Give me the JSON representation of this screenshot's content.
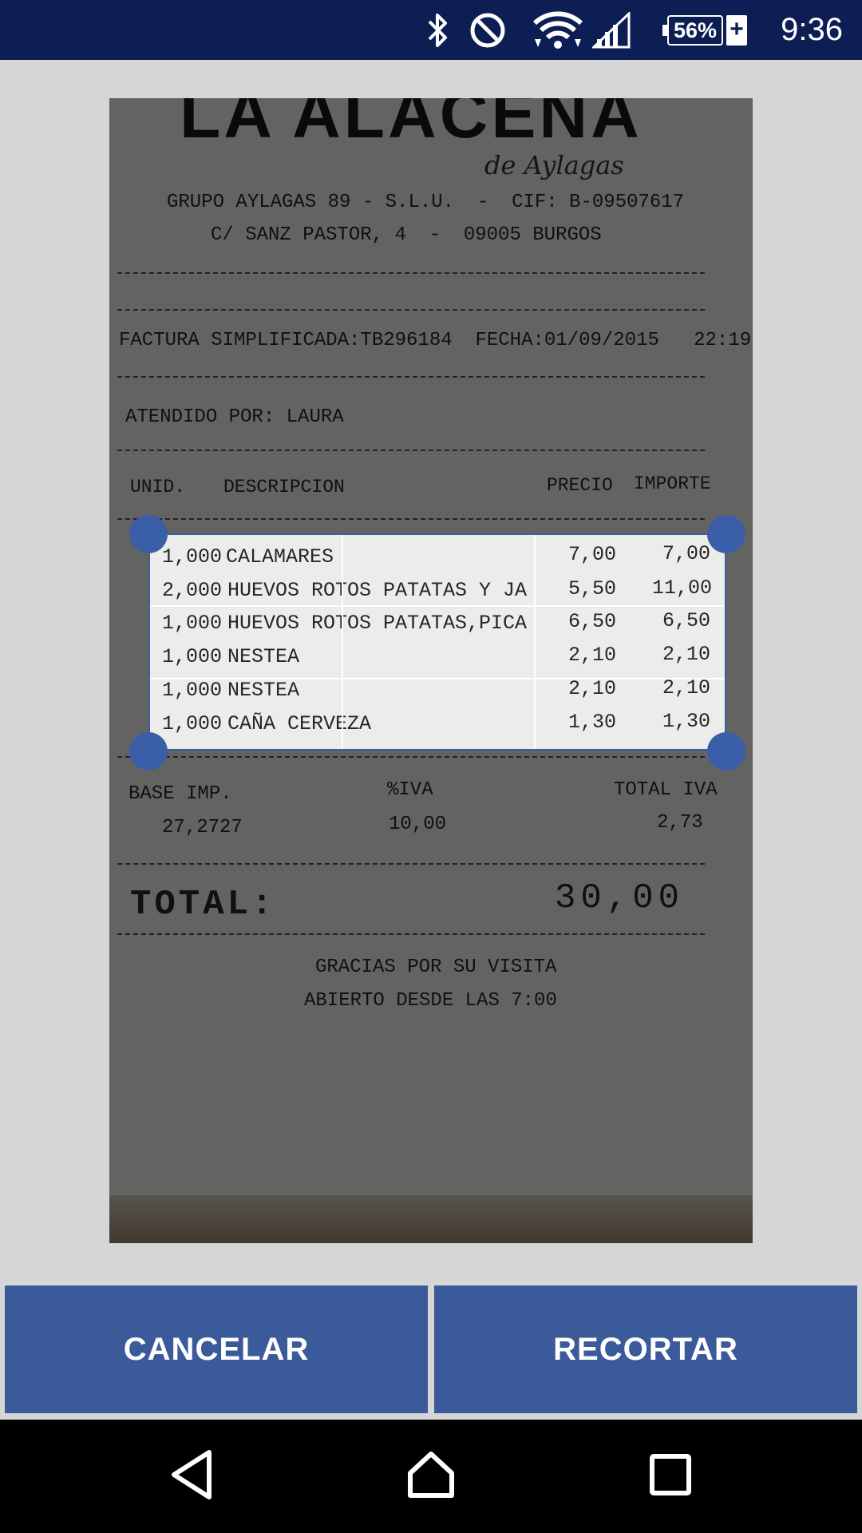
{
  "status_bar": {
    "battery_percent": "56%",
    "battery_charging": "+",
    "time": "9:36",
    "icons": [
      "bluetooth-icon",
      "do-not-disturb-icon",
      "wifi-icon",
      "cell-signal-icon",
      "battery-icon"
    ]
  },
  "receipt": {
    "logo": "LA ALACENA",
    "logo_sub": "de Aylagas",
    "company": "GRUPO AYLAGAS 89 - S.L.U.  -  CIF: B-09507617",
    "address": "C/ SANZ PASTOR, 4  -  09005 BURGOS",
    "invoice_line": "FACTURA SIMPLIFICADA:TB296184  FECHA:01/09/2015   22:19",
    "attended": "ATENDIDO POR: LAURA",
    "header": {
      "unid": "UNID.",
      "descripcion": "DESCRIPCION",
      "precio": "PRECIO",
      "importe": "IMPORTE"
    },
    "items": [
      {
        "qty": "1,000",
        "desc": "CALAMARES",
        "price": "7,00",
        "amount": "7,00"
      },
      {
        "qty": "2,000",
        "desc": "HUEVOS ROTOS PATATAS Y JA",
        "price": "5,50",
        "amount": "11,00"
      },
      {
        "qty": "1,000",
        "desc": "HUEVOS ROTOS PATATAS,PICA",
        "price": "6,50",
        "amount": "6,50"
      },
      {
        "qty": "1,000",
        "desc": "NESTEA",
        "price": "2,10",
        "amount": "2,10"
      },
      {
        "qty": "1,000",
        "desc": "NESTEA",
        "price": "2,10",
        "amount": "2,10"
      },
      {
        "qty": "1,000",
        "desc": "CAÑA CERVEZA",
        "price": "1,30",
        "amount": "1,30"
      }
    ],
    "tax_header": {
      "base": "BASE IMP.",
      "iva": "%IVA",
      "total_iva": "TOTAL IVA"
    },
    "tax_values": {
      "base": "27,2727",
      "iva": "10,00",
      "total_iva": "2,73"
    },
    "total_label": "TOTAL:",
    "total_value": "30,00",
    "thanks": "GRACIAS POR SU VISITA",
    "open_since": "ABIERTO DESDE LAS 7:00"
  },
  "actions": {
    "cancel_label": "CANCELAR",
    "crop_label": "RECORTAR"
  },
  "colors": {
    "status_bar": "#0d1e55",
    "accent": "#3b5a9a",
    "crop_frame": "#3b5ea8"
  }
}
